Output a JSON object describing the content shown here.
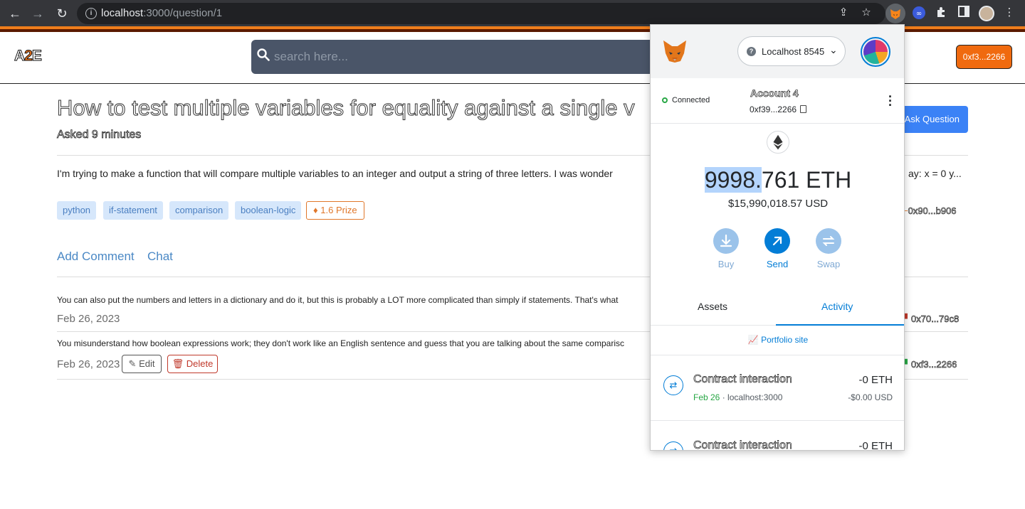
{
  "browser": {
    "url_host": "localhost",
    "url_path": ":3000/question/1"
  },
  "site": {
    "logo_text": "A",
    "logo_accent": "2",
    "logo_suffix": "E",
    "search_placeholder": "search here...",
    "account_button": "0xf3...2266"
  },
  "question": {
    "title": "How to test multiple variables for equality against a single v",
    "asked": "Asked 9 minutes",
    "ask_button": "Ask Question",
    "body": "I'm trying to make a function that will compare multiple variables to an integer and output a string of three letters. I was wonder",
    "body_tail": "ay: x = 0 y...",
    "tags": [
      "python",
      "if-statement",
      "comparison",
      "boolean-logic"
    ],
    "prize": "1.6 Prize",
    "author_address": "0x90...b906"
  },
  "tabs": {
    "add_comment": "Add Comment",
    "chat": "Chat"
  },
  "comments": [
    {
      "text": "You can also put the numbers and letters in a dictionary and do it, but this is probably a LOT more complicated than simply if statements. That's what",
      "date": "Feb 26, 2023",
      "author": "0x70...79c8"
    },
    {
      "text": "You misunderstand how boolean expressions work; they don't work like an English sentence and guess that you are talking about the same comparisc",
      "date": "Feb 26, 2023",
      "edit": "Edit",
      "delete": "Delete",
      "author": "0xf3...2266"
    }
  ],
  "metamask": {
    "network": "Localhost 8545",
    "connected": "Connected",
    "account_name": "Account 4",
    "account_address": "0xf39...2266",
    "balance_highlight": "9998.",
    "balance_rest": "761",
    "balance_unit": "ETH",
    "balance_usd": "$15,990,018.57 USD",
    "actions": [
      "Buy",
      "Send",
      "Swap"
    ],
    "tabs": [
      "Assets",
      "Activity"
    ],
    "portfolio": "Portfolio site",
    "transactions": [
      {
        "title": "Contract interaction",
        "amount": "-0 ETH",
        "date": "Feb 26",
        "origin": "localhost:3000",
        "usd": "-$0.00 USD"
      },
      {
        "title": "Contract interaction",
        "amount": "-0 ETH"
      }
    ],
    "colors": {
      "accent": "#037dd6",
      "green": "#28a745"
    }
  },
  "colors": {
    "brand_orange": "#f06a0f",
    "tag_bg": "#d6e7fb",
    "primary": "#3b82f6"
  }
}
